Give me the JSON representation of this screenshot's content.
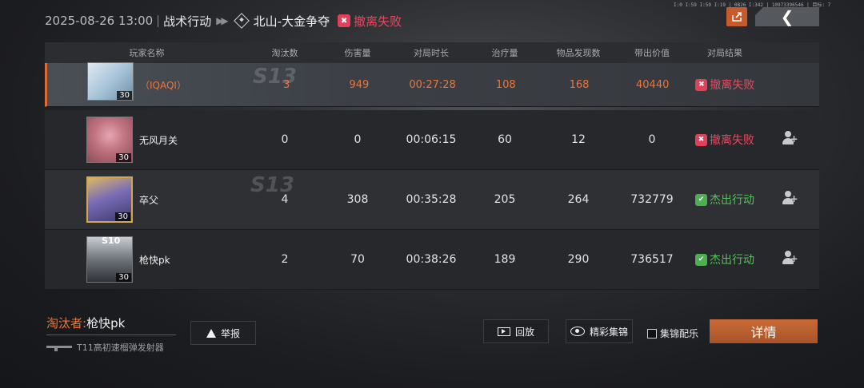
{
  "header": {
    "datetime": "2025-08-26 13:00",
    "mode": "战术行动",
    "map": "北山-大金争夺",
    "result": "撤离失败"
  },
  "top_info": "I:0 I:59 I:59 I:19 | 0B26 I:342 | 10973396546 | 目标: 7",
  "icons": {
    "share": "share-icon",
    "back": "back-chevron-icon",
    "map": "map-diamond-icon",
    "fail": "fail-icon",
    "success": "success-icon",
    "add_friend": "add-friend-icon",
    "report": "warning-icon",
    "replay": "replay-icon",
    "highlight": "eye-icon",
    "weapon": "rifle-icon"
  },
  "colors": {
    "accent": "#e06a32",
    "fail": "#e84a62",
    "success": "#58c25a"
  },
  "columns": [
    "玩家名称",
    "淘汰数",
    "伤害量",
    "对局时长",
    "治疗量",
    "物品发现数",
    "带出价值",
    "对局结果"
  ],
  "players": [
    {
      "name": "（IQAQI）",
      "level": "30",
      "kills": "3",
      "damage": "949",
      "duration": "00:27:28",
      "heal": "108",
      "items": "168",
      "value": "40440",
      "result": "撤离失败",
      "result_type": "fail",
      "self": true
    },
    {
      "name": "无风月关",
      "level": "30",
      "kills": "0",
      "damage": "0",
      "duration": "00:06:15",
      "heal": "60",
      "items": "12",
      "value": "0",
      "result": "撤离失败",
      "result_type": "fail",
      "self": false
    },
    {
      "name": "卒父",
      "level": "30",
      "kills": "4",
      "damage": "308",
      "duration": "00:35:28",
      "heal": "205",
      "items": "264",
      "value": "732779",
      "result": "杰出行动",
      "result_type": "success",
      "self": false
    },
    {
      "name": "枪快pk",
      "level": "30",
      "kills": "2",
      "damage": "70",
      "duration": "00:38:26",
      "heal": "189",
      "items": "290",
      "value": "736517",
      "result": "杰出行动",
      "result_type": "success",
      "self": false
    }
  ],
  "season_badge": "S13",
  "avatar_badge": "S10",
  "footer": {
    "eliminator_label": "淘汰者:",
    "eliminator_name": "枪快pk",
    "weapon": "T11高初速榴弹发射器",
    "report": "举报",
    "replay": "回放",
    "highlight": "精彩集锦",
    "bgm": "集锦配乐",
    "bgm_checked": false,
    "detail": "详情"
  }
}
